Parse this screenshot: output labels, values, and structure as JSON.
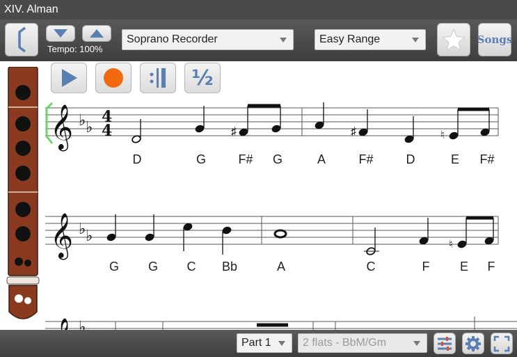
{
  "window": {
    "title": "XIV. Alman"
  },
  "toolbar": {
    "tempo_label": "Tempo: 100%",
    "instrument": "Soprano Recorder",
    "range": "Easy Range",
    "songs_label": "Songs"
  },
  "playback": {
    "half_label": "½"
  },
  "score": {
    "row1_notes": [
      "D",
      "G",
      "F#",
      "G",
      "A",
      "F#",
      "D",
      "E",
      "F#"
    ],
    "row2_notes": [
      "G",
      "G",
      "C",
      "Bb",
      "A",
      "C",
      "F",
      "E",
      "F"
    ]
  },
  "bottom": {
    "part": "Part 1",
    "key": "2 flats - BbM/Gm"
  },
  "colors": {
    "accent": "#5b7fb3",
    "record": "#f26a10",
    "recorder": "#8a3a1e",
    "highlight": "#6fd36f"
  }
}
